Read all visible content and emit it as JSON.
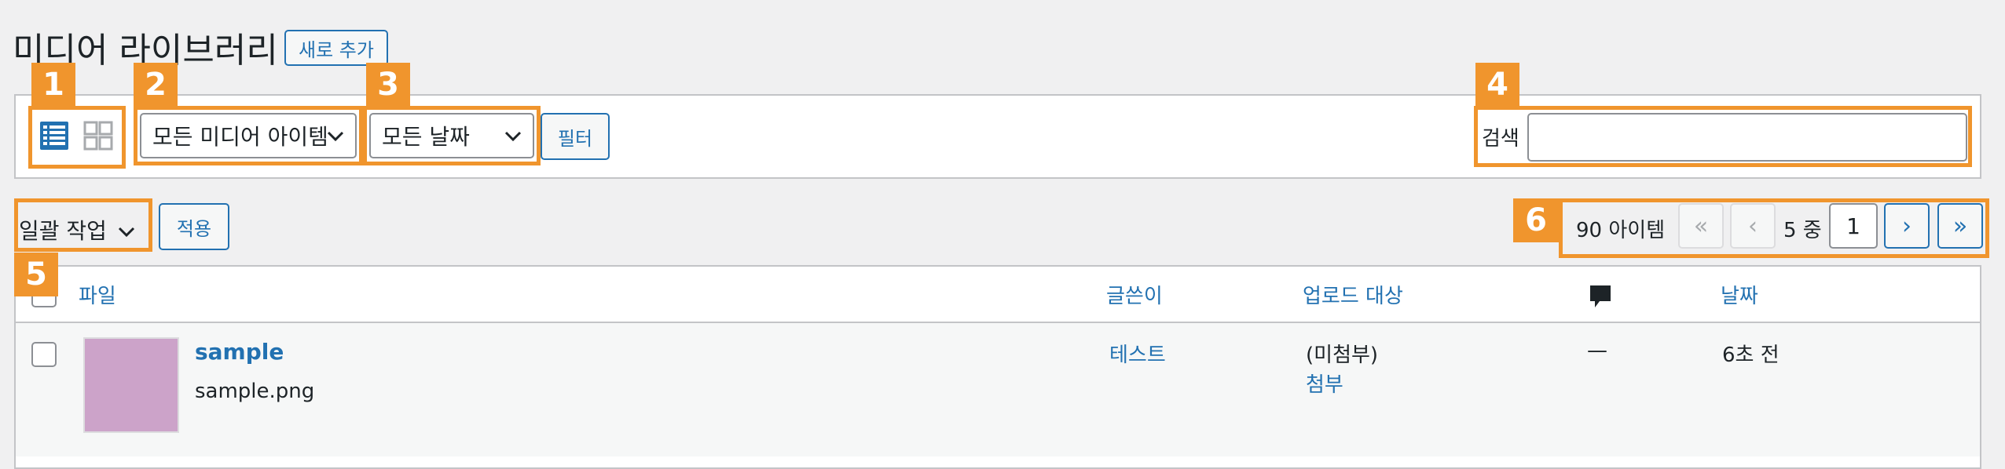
{
  "header": {
    "title": "미디어 라이브러리",
    "add_new_label": "새로 추가"
  },
  "toolbar": {
    "media_filter_value": "모든 미디어 아이템",
    "date_filter_value": "모든 날짜",
    "filter_button_label": "필터",
    "search_label": "검색",
    "search_value": ""
  },
  "bulk": {
    "select_value": "일괄 작업",
    "apply_label": "적용"
  },
  "pagination": {
    "items_count": "90 아이템",
    "first": "«",
    "prev": "‹",
    "next": "›",
    "last": "»",
    "current_page": "1",
    "of_text": "5 중"
  },
  "table": {
    "columns": {
      "file": "파일",
      "author": "글쓴이",
      "uploaded_to": "업로드 대상",
      "date": "날짜"
    },
    "rows": [
      {
        "title": "sample",
        "filename": "sample.png",
        "author": "테스트",
        "uploaded_to": "(미첨부)",
        "attach_link": "첨부",
        "comments": "—",
        "date": "6초 전",
        "thumb_color": "#cca3c9"
      }
    ]
  },
  "annotations": [
    "1",
    "2",
    "3",
    "4",
    "5",
    "6"
  ],
  "colors": {
    "accent": "#2271b1",
    "annotation": "#f0952d"
  }
}
